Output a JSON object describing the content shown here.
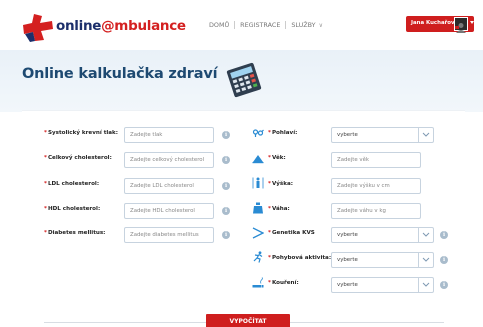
{
  "logo": {
    "part1": "online",
    "part2": "@mbulance"
  },
  "nav": {
    "home": "DOMŮ",
    "registration": "REGISTRACE",
    "services": "SLUŽBY"
  },
  "user": {
    "name": "Jana Kuchařová"
  },
  "title": "Online kalkulačka zdraví",
  "left_fields": [
    {
      "label": "Systolický krevní tlak:",
      "placeholder": "Zadejte tlak"
    },
    {
      "label": "Celkový cholesterol:",
      "placeholder": "Zadejte celkový cholesterol"
    },
    {
      "label": "LDL cholesterol:",
      "placeholder": "Zadejte LDL cholesterol"
    },
    {
      "label": "HDL cholesterol:",
      "placeholder": "Zadejte HDL cholesterol"
    },
    {
      "label": "Diabetes mellitus:",
      "placeholder": "Zadejte diabetes mellitus"
    }
  ],
  "right_fields": [
    {
      "label": "Pohlaví:",
      "value": "vyberte",
      "icon": "gender-icon"
    },
    {
      "label": "Věk:",
      "placeholder": "Zadejte věk",
      "icon": "age-icon"
    },
    {
      "label": "Výška:",
      "placeholder": "Zadejte výšku v cm",
      "icon": "height-icon"
    },
    {
      "label": "Váha:",
      "placeholder": "Zadejte váhu v kg",
      "icon": "weight-icon"
    },
    {
      "label": "Genetika KVS",
      "value": "vyberte",
      "icon": "genetics-icon"
    },
    {
      "label": "Pohybová aktivita:",
      "value": "vyberte",
      "icon": "activity-icon"
    },
    {
      "label": "Kouření:",
      "value": "vyberte",
      "icon": "smoking-icon"
    }
  ],
  "info_symbol": "i",
  "submit": "VYPOČÍTAT",
  "colors": {
    "brand_red": "#cf1e1e",
    "brand_navy": "#1c2f6b",
    "title_blue": "#1e4a72",
    "icon_blue": "#2a8bd3"
  }
}
